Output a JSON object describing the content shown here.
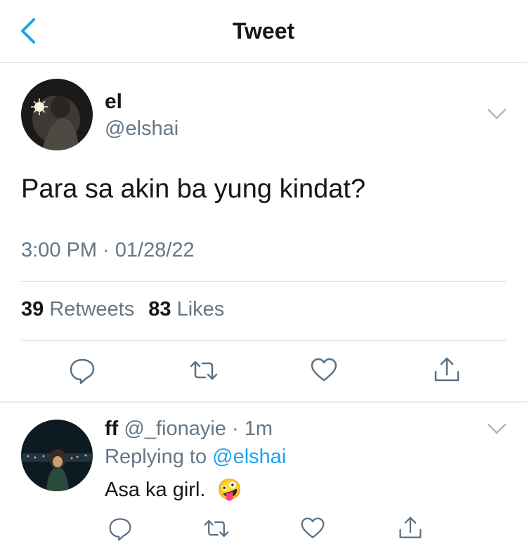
{
  "header": {
    "title": "Tweet",
    "back_icon": "chevron-left-icon"
  },
  "tweet": {
    "author_name": "el",
    "author_handle": "@elshai",
    "text": "Para sa akin ba yung kindat?",
    "timestamp": "3:00 PM · 01/28/22",
    "retweets_count": "39",
    "retweets_label": "Retweets",
    "likes_count": "83",
    "likes_label": "Likes",
    "actions": [
      "reply-icon",
      "retweet-icon",
      "like-icon",
      "share-icon"
    ]
  },
  "reply": {
    "author_name": "ff",
    "author_handle": "@_fionayie",
    "time": "· 1m",
    "replying_prefix": "Replying to",
    "replying_to": "@elshai",
    "text": "Asa ka girl.",
    "emoji": "🤪"
  },
  "colors": {
    "accent": "#1da1f2",
    "muted": "#657786",
    "icon": "#5b7083"
  }
}
